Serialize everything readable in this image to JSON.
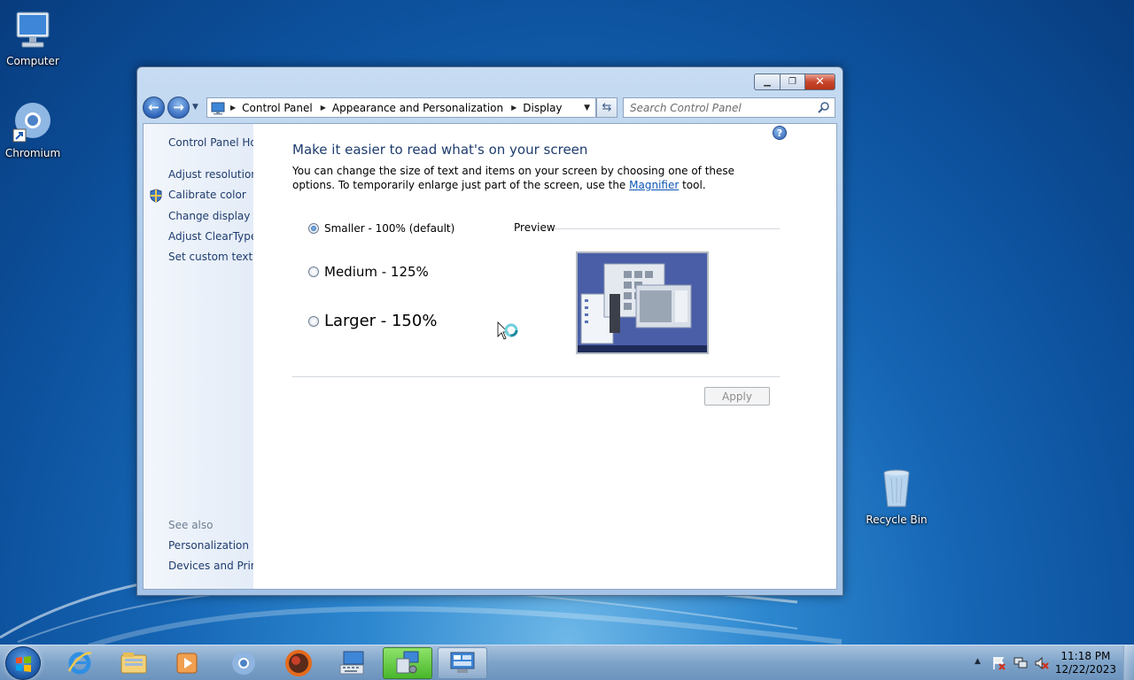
{
  "desktop": {
    "icons": [
      {
        "label": "Computer",
        "icon": "computer-icon"
      },
      {
        "label": "Chromium",
        "icon": "chromium-icon"
      },
      {
        "label": "Recycle Bin",
        "icon": "recycle-bin-icon"
      }
    ]
  },
  "window": {
    "controls": {
      "minimize": "minimize-icon",
      "maximize": "maximize-icon",
      "close": "close-icon"
    },
    "breadcrumb": [
      "Control Panel",
      "Appearance and Personalization",
      "Display"
    ],
    "search_placeholder": "Search Control Panel",
    "sidebar": {
      "home": "Control Panel Hor",
      "links": [
        "Adjust resolution",
        "Calibrate color",
        "Change display se",
        "Adjust ClearType t",
        "Set custom text siz"
      ],
      "see_also_label": "See also",
      "see_also": [
        "Personalization",
        "Devices and Printe"
      ]
    },
    "content": {
      "heading": "Make it easier to read what's on your screen",
      "description_before": "You can change the size of text and items on your screen by choosing one of these options. To temporarily enlarge just part of the screen, use the ",
      "description_link": "Magnifier",
      "description_after": " tool.",
      "options": [
        {
          "label": "Smaller - 100% (default)",
          "selected": true
        },
        {
          "label": "Medium - 125%",
          "selected": false
        },
        {
          "label": "Larger - 150%",
          "selected": false
        }
      ],
      "preview_label": "Preview",
      "apply_label": "Apply",
      "apply_enabled": false
    }
  },
  "taskbar": {
    "items": [
      "start-orb-icon",
      "internet-explorer-icon",
      "file-explorer-icon",
      "media-player-icon",
      "chromium-icon",
      "firefox-icon",
      "keyboard-app-icon",
      "display-settings-icon",
      "control-panel-icon"
    ],
    "clock_time": "11:18 PM",
    "clock_date": "12/22/2023"
  },
  "colors": {
    "accent": "#1e3c6e",
    "link": "#0b55b5",
    "active_taskbar": "#48b72b"
  }
}
